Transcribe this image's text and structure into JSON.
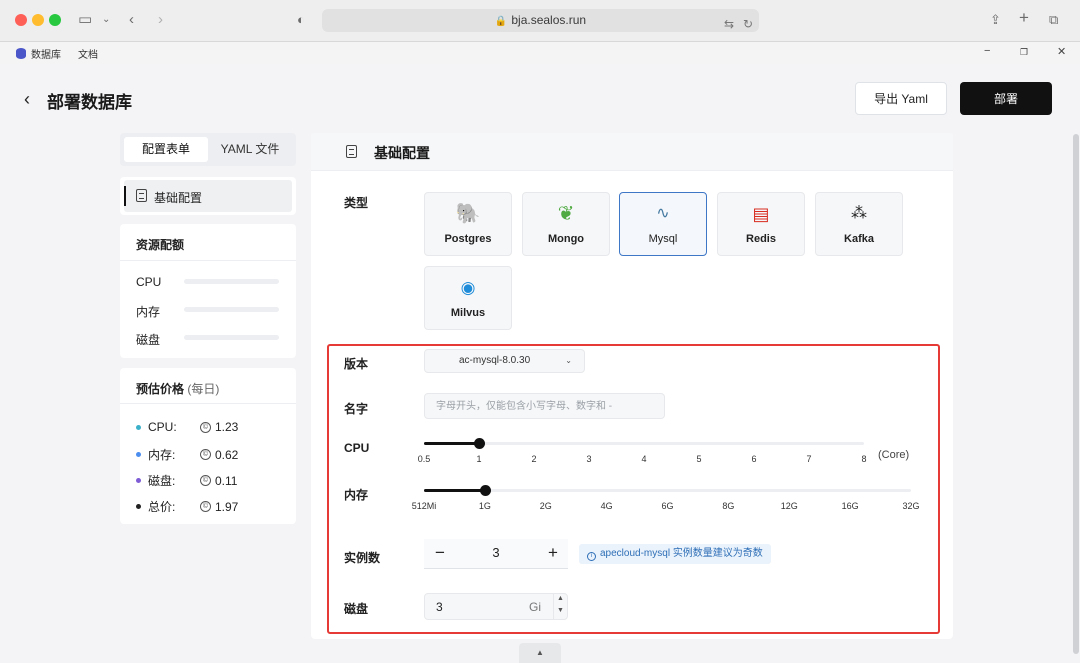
{
  "browser": {
    "url": "bja.sealos.run"
  },
  "apptabs": {
    "db_label": "数据库",
    "docs_label": "文档"
  },
  "header": {
    "title": "部署数据库",
    "export_label": "导出 Yaml",
    "deploy_label": "部署"
  },
  "left": {
    "tabs": [
      "配置表单",
      "YAML 文件"
    ],
    "nav_item": "基础配置",
    "resource_title": "资源配额",
    "resources": [
      "CPU",
      "内存",
      "磁盘"
    ],
    "price_title": "预估价格",
    "price_sub": "(每日)",
    "prices": [
      {
        "label": "CPU:",
        "value": "1.23",
        "color": "#3bb0c9"
      },
      {
        "label": "内存:",
        "value": "0.62",
        "color": "#4c8df0"
      },
      {
        "label": "磁盘:",
        "value": "0.11",
        "color": "#7e5cd6"
      },
      {
        "label": "总价:",
        "value": "1.97",
        "color": "#222222"
      }
    ]
  },
  "main": {
    "title": "基础配置",
    "type_label": "类型",
    "db_types": [
      {
        "name": "Postgres",
        "icon": "postgres-icon",
        "color": "#336791"
      },
      {
        "name": "Mongo",
        "icon": "mongo-leaf-icon",
        "color": "#4faa41"
      },
      {
        "name": "Mysql",
        "icon": "mysql-dolphin-icon",
        "color": "#4479a1"
      },
      {
        "name": "Redis",
        "icon": "redis-icon",
        "color": "#d82c20"
      },
      {
        "name": "Kafka",
        "icon": "kafka-icon",
        "color": "#222222"
      },
      {
        "name": "Milvus",
        "icon": "milvus-eye-icon",
        "color": "#1e8cd8"
      }
    ],
    "selected_type": "Mysql",
    "version_label": "版本",
    "version_value": "ac-mysql-8.0.30",
    "name_label": "名字",
    "name_placeholder": "字母开头，仅能包含小写字母、数字和 -",
    "cpu_label": "CPU",
    "cpu_ticks": [
      "0.5",
      "1",
      "2",
      "3",
      "4",
      "5",
      "6",
      "7",
      "8"
    ],
    "cpu_selected_index": 1,
    "cpu_unit": "(Core)",
    "mem_label": "内存",
    "mem_ticks": [
      "512Mi",
      "1G",
      "2G",
      "4G",
      "6G",
      "8G",
      "12G",
      "16G",
      "32G"
    ],
    "mem_selected_index": 1,
    "replicas_label": "实例数",
    "replicas_value": "3",
    "replicas_tip": "apecloud-mysql 实例数量建议为奇数",
    "disk_label": "磁盘",
    "disk_value": "3",
    "disk_unit": "Gi"
  }
}
